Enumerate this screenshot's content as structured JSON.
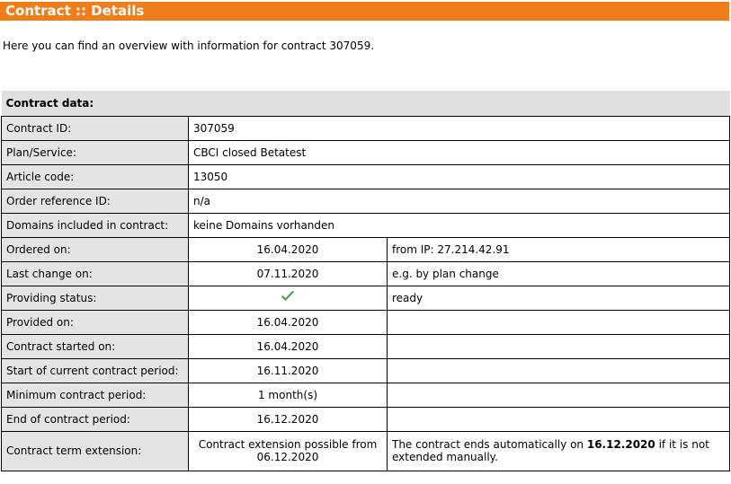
{
  "header": {
    "title": "Contract :: Details"
  },
  "intro": "Here you can find an overview with information for contract 307059.",
  "table": {
    "heading": "Contract data:",
    "rows": {
      "contract_id": {
        "label": "Contract ID:",
        "value": "307059"
      },
      "plan": {
        "label": "Plan/Service:",
        "value": "CBCI closed Betatest"
      },
      "article_code": {
        "label": "Article code:",
        "value": "13050"
      },
      "order_ref": {
        "label": "Order reference ID:",
        "value": "n/a"
      },
      "domains": {
        "label": "Domains included in contract:",
        "value": "keine Domains vorhanden"
      },
      "ordered_on": {
        "label": "Ordered on:",
        "value": "16.04.2020",
        "note": "from IP: 27.214.42.91"
      },
      "last_change": {
        "label": "Last change on:",
        "value": "07.11.2020",
        "note": "e.g. by plan change"
      },
      "providing_status": {
        "label": "Providing status:",
        "icon": "check-icon",
        "note": "ready"
      },
      "provided_on": {
        "label": "Provided on:",
        "value": "16.04.2020"
      },
      "contract_started": {
        "label": "Contract started on:",
        "value": "16.04.2020"
      },
      "current_period_start": {
        "label": "Start of current contract period:",
        "value": "16.11.2020"
      },
      "min_period": {
        "label": "Minimum contract period:",
        "value": "1 month(s)"
      },
      "period_end": {
        "label": "End of contract period:",
        "value": "16.12.2020"
      },
      "term_extension": {
        "label": "Contract term extension:",
        "value_line1": "Contract extension possible from",
        "value_line2": "06.12.2020",
        "note_pre": "The contract ends automatically on ",
        "note_date": "16.12.2020",
        "note_post": " if it is not extended manually."
      }
    }
  },
  "colors": {
    "title_bar": "#ee7d1a",
    "label_bg": "#e4e4e4",
    "check": "#3a9b4d"
  }
}
